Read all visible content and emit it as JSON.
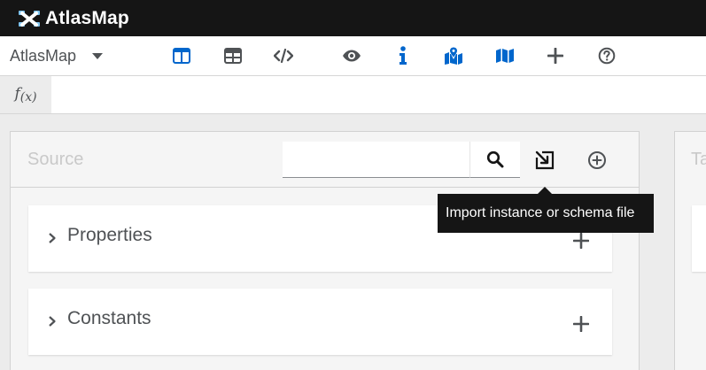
{
  "brand": {
    "name": "AtlasMap"
  },
  "toolbar": {
    "app_selector": "AtlasMap",
    "icons": [
      {
        "name": "columns-icon",
        "active_color": "#0066cc"
      },
      {
        "name": "table-icon"
      },
      {
        "name": "code-icon"
      },
      {
        "name": "eye-icon"
      },
      {
        "name": "info-icon",
        "active_color": "#0066cc"
      },
      {
        "name": "map-marked-icon",
        "active_color": "#0066cc"
      },
      {
        "name": "map-icon",
        "active_color": "#0066cc"
      },
      {
        "name": "plus-icon"
      },
      {
        "name": "question-circle-icon"
      }
    ]
  },
  "fxbar": {
    "label": "f",
    "sub": "(x)"
  },
  "source": {
    "title": "Source",
    "search": {
      "value": "",
      "placeholder": ""
    },
    "sections": [
      {
        "label": "Properties"
      },
      {
        "label": "Constants"
      }
    ]
  },
  "target": {
    "title": "Ta"
  },
  "tooltip": {
    "text": "Import instance or schema file"
  },
  "colors": {
    "topbar": "#151515",
    "accent": "#0066cc",
    "icon_gray": "#4f5255"
  }
}
